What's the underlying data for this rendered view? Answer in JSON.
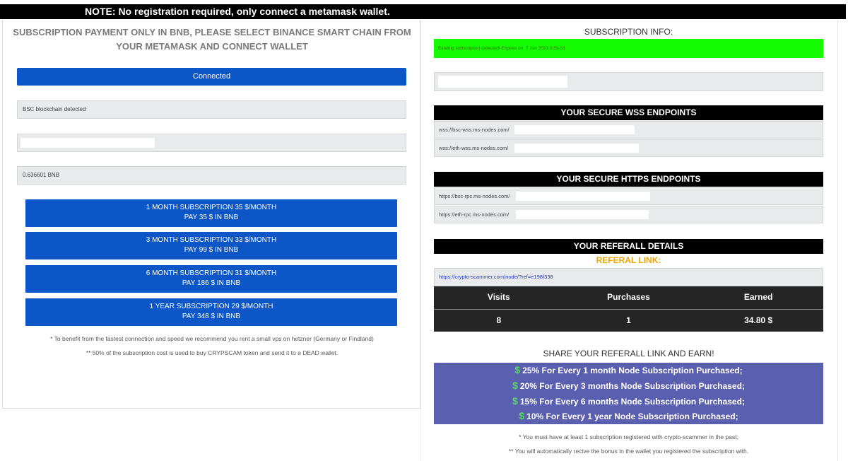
{
  "note": "NOTE: No registration required, only connect a metamask wallet.",
  "left": {
    "title": "SUBSCRIPTION PAYMENT ONLY IN BNB, PLEASE SELECT BINANCE SMART CHAIN FROM YOUR METAMASK AND CONNECT WALLET",
    "connect_label": "Connected",
    "chain_status": "BSC blockchain detected",
    "balance": "0.636601 BNB",
    "subscriptions": [
      {
        "line1": "1 MONTH SUBSCRIPTION 35 $/MONTH",
        "line2": "PAY 35 $ IN BNB"
      },
      {
        "line1": "3 MONTH SUBSCRIPTION 33 $/MONTH",
        "line2": "PAY 99 $ IN BNB"
      },
      {
        "line1": "6 MONTH SUBSCRIPTION 31 $/MONTH",
        "line2": "PAY 186 $ IN BNB"
      },
      {
        "line1": "1 YEAR SUBSCRIPTION 29 $/MONTH",
        "line2": "PAY 348 $ IN BNB"
      }
    ],
    "note1": "* To benefit from the fastest connection and speed we recommend you rent a small vps on hetzner (Germany or Findland)",
    "note2": "** 50% of the subscription cost is used to buy CRYPSCAM token and send it to a DEAD wallet."
  },
  "right": {
    "subscription_title": "SUBSCRIPTION INFO:",
    "subscription_status": "Existing subscription detected! Expires on: 7 Jun 2023 3:59:53",
    "wss_title": "YOUR SECURE WSS ENDPOINTS",
    "wss": [
      "wss://bsc-wss.ms-nodes.com/",
      "wss://eth-wss.ms-nodes.com/"
    ],
    "https_title": "YOUR SECURE HTTPS ENDPOINTS",
    "https": [
      "https://bsc-rpc.ms-nodes.com/",
      "https://eth-rpc.ms-nodes.com/"
    ],
    "referral_title": "YOUR REFERALL DETAILS",
    "referral_label": "REFERAL LINK:",
    "referral_link": "https://crypto-scammer.com/node/?ref=e198f338",
    "stats_headers": [
      "Visits",
      "Purchases",
      "Earned"
    ],
    "stats_values": [
      "8",
      "1",
      "34.80 $"
    ],
    "share_title": "SHARE YOUR REFERALL LINK AND EARN!",
    "promo": [
      "25% For Every 1 month Node Subscription Purchased;",
      "20% For Every 3 months Node Subscription Purchased;",
      "15% For Every 6 months Node Subscription Purchased;",
      "10% For Every 1 year Node Subscription Purchased;"
    ],
    "promo_symbol": "$",
    "note1": "* You must have at least 1 subscription registered with crypto-scammer in the past;",
    "note2": "** You will automatically recive the bonus in the wallet you registered the subscription with."
  },
  "colors": {
    "accent_blue": "#0d56c7",
    "status_green": "#15fb00",
    "referral_orange": "#f0a500",
    "promo_purple": "#5b5fb0"
  }
}
